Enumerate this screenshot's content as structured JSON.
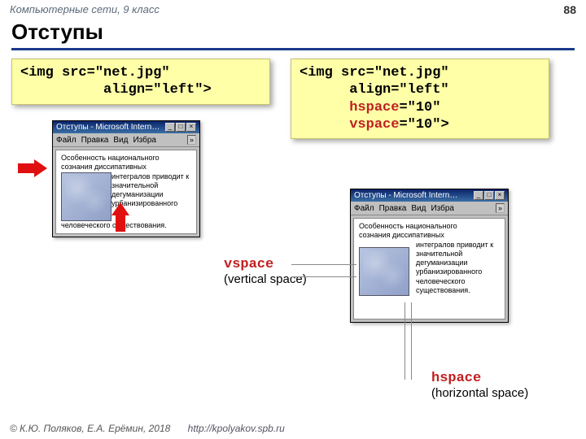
{
  "header": {
    "course": "Компьютерные сети, 9 класс",
    "page": "88"
  },
  "title": "Отступы",
  "code_left": {
    "l1a": "<img src=\"net.jpg\"",
    "l2_indent": "          ",
    "l2a": "align=\"left\">"
  },
  "code_right": {
    "l1": "<img src=\"net.jpg\"",
    "indent": "      ",
    "l2": "align=\"left\"",
    "attr3": "hspace",
    "val3": "=\"10\"",
    "attr4": "vspace",
    "val4": "=\"10\">"
  },
  "browser": {
    "title": "Отступы - Microsoft Intern…",
    "menu": {
      "file": "Файл",
      "edit": "Правка",
      "view": "Вид",
      "fav": "Избра",
      "chev": "»"
    }
  },
  "sample_left": {
    "pre": "Особенность национального\nсознания диссипативных",
    "wrap": "интегралов приводит к значительной дегуманизации урбанизированного",
    "post": "человеческого существования."
  },
  "sample_right": {
    "pre": "Особенность национального\nсознания диссипативных",
    "wrap": "интегралов приводит к значительной дегуманизации урбанизированного человеческого существования."
  },
  "labels": {
    "vspace": "vspace",
    "vspace_en": "(vertical space)",
    "hspace": "hspace",
    "hspace_en": "(horizontal space)"
  },
  "footer": {
    "copyright": "© К.Ю. Поляков, Е.А. Ерёмин, 2018",
    "url": "http://kpolyakov.spb.ru"
  }
}
